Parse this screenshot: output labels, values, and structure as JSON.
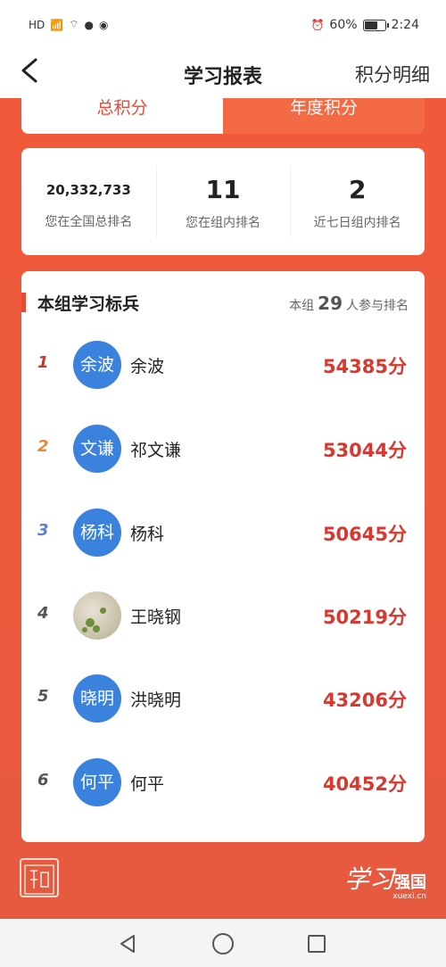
{
  "status_bar": {
    "left_icons": [
      "HD",
      "5G",
      "signal-icon",
      "wifi-icon",
      "wechat-icon",
      "globe-icon"
    ],
    "battery_pct": "60%",
    "time": "2:24"
  },
  "nav": {
    "title": "学习报表",
    "right_link": "积分明细"
  },
  "tabs": [
    {
      "label": "总积分"
    },
    {
      "label": "年度积分"
    }
  ],
  "ranking": {
    "national": {
      "value": "20,332,733",
      "label": "您在全国总排名"
    },
    "group": {
      "value": "11",
      "label": "您在组内排名"
    },
    "week": {
      "value": "2",
      "label": "近七日组内排名"
    }
  },
  "list": {
    "title": "本组学习标兵",
    "prefix": "本组",
    "count": "29",
    "suffix": "人参与排名",
    "rows": [
      {
        "rank": "1",
        "avatar": "余波",
        "name": "余波",
        "score": "54385分",
        "rank_color": "#c8372d"
      },
      {
        "rank": "2",
        "avatar": "文谦",
        "name": "祁文谦",
        "score": "53044分",
        "rank_color": "#e88a2e"
      },
      {
        "rank": "3",
        "avatar": "杨科",
        "name": "杨科",
        "score": "50645分",
        "rank_color": "#5b7fd6"
      },
      {
        "rank": "4",
        "avatar": "",
        "name": "王晓钢",
        "score": "50219分",
        "rank_color": "#555555"
      },
      {
        "rank": "5",
        "avatar": "晓明",
        "name": "洪晓明",
        "score": "43206分",
        "rank_color": "#555555"
      },
      {
        "rank": "6",
        "avatar": "何平",
        "name": "何平",
        "score": "40452分",
        "rank_color": "#555555"
      }
    ]
  },
  "footer": {
    "right_brand": "学习",
    "right_brand2": "强国",
    "right_url": "xuexi.cn"
  },
  "colors": {
    "accent": "#e84a3a",
    "score": "#d8382f",
    "avatar": "#3b82df"
  }
}
